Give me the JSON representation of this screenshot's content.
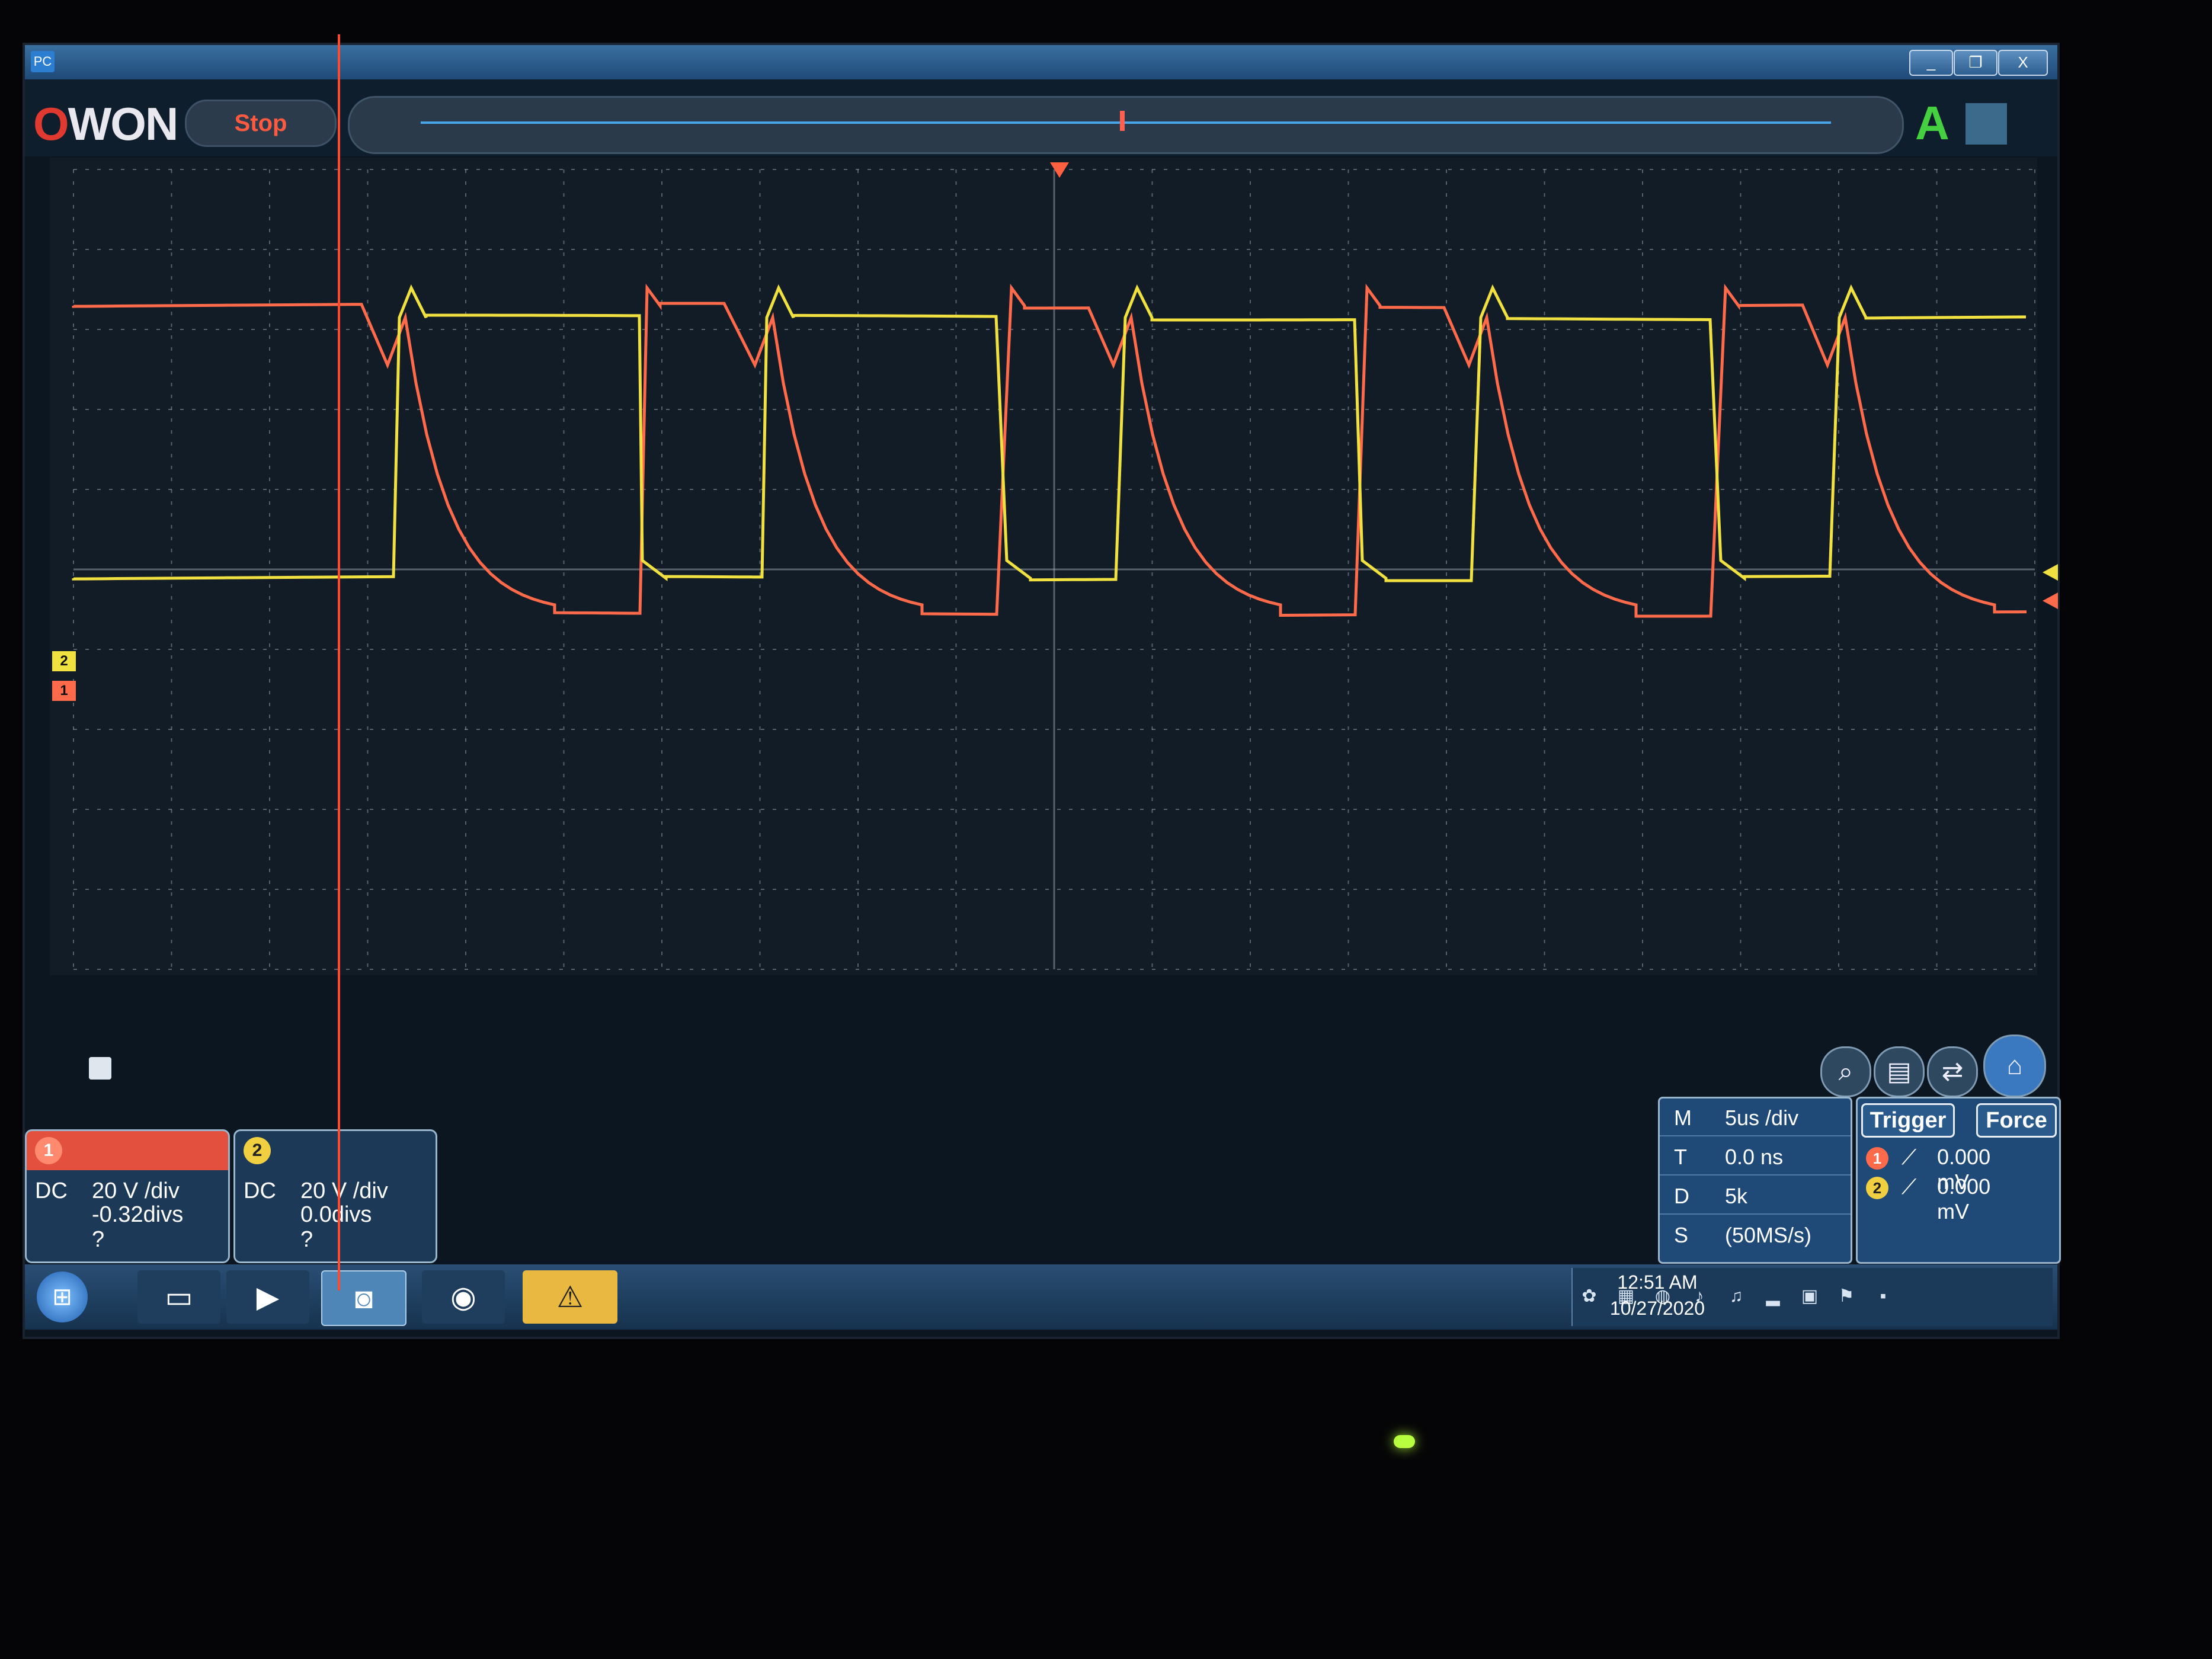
{
  "window": {
    "badge": "PC",
    "buttons": {
      "minimize": "_",
      "restore": "❐",
      "close": "X"
    }
  },
  "toolbar": {
    "logo_o": "O",
    "logo_rest": "WON",
    "run_state_label": "Stop",
    "auto_label": "A"
  },
  "channels": [
    {
      "number": "1",
      "coupling": "DC",
      "scale": "20 V /div",
      "offset": "-0.32divs",
      "probe": "?",
      "color": "#ff6a4a"
    },
    {
      "number": "2",
      "coupling": "DC",
      "scale": "20 V /div",
      "offset": "0.0divs",
      "probe": "?",
      "color": "#f0e040"
    }
  ],
  "timebase": {
    "rows": [
      {
        "key": "M",
        "value": "5us /div"
      },
      {
        "key": "T",
        "value": "0.0 ns"
      },
      {
        "key": "D",
        "value": "5k"
      },
      {
        "key": "S",
        "value": "(50MS/s)"
      }
    ]
  },
  "trigger": {
    "trigger_label": "Trigger",
    "force_label": "Force",
    "rows": [
      {
        "channel": "1",
        "level": "0.000 mV"
      },
      {
        "channel": "2",
        "level": "0.000 mV"
      }
    ]
  },
  "taskbar": {
    "time": "12:51 AM",
    "date": "10/27/2020"
  },
  "colors": {
    "ch1": "#ff6a4a",
    "ch2": "#f0e040",
    "grid": "#9aa6b2",
    "screen_bg": "#121c26"
  },
  "icons": [
    "search-icon",
    "save-icon",
    "export-icon",
    "home-icon",
    "start-icon",
    "folder-icon",
    "media-icon",
    "owon-app-icon",
    "chrome-icon",
    "warning-icon"
  ]
}
